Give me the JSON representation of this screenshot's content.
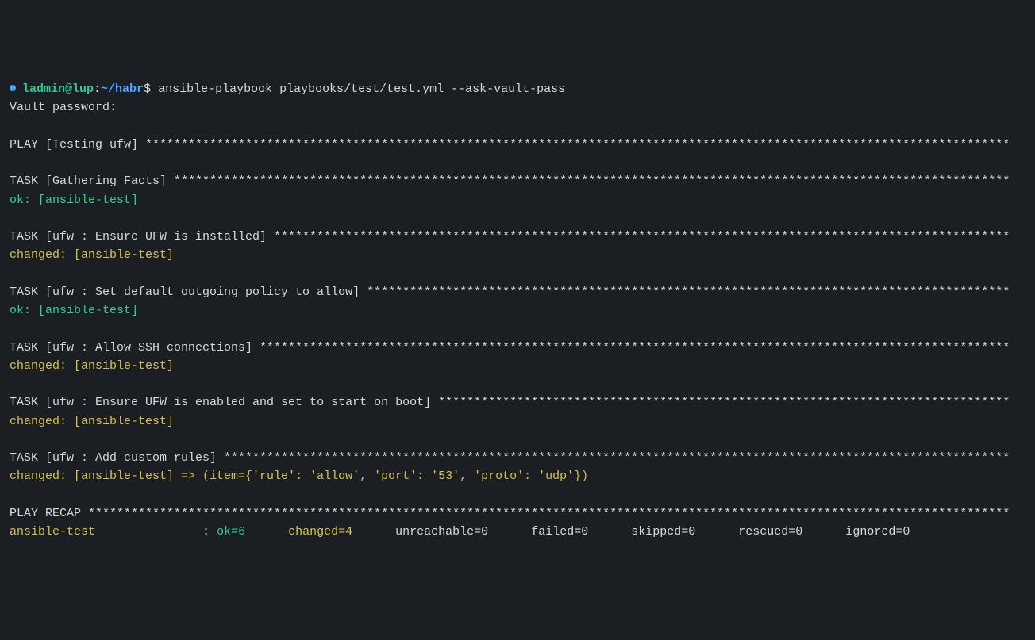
{
  "prompt": {
    "user_host": "ladmin@lup",
    "colon": ":",
    "path": "~/habr",
    "dollar": "$"
  },
  "command": "ansible-playbook playbooks/test/test.yml --ask-vault-pass",
  "vault_prompt": "Vault password:",
  "play_header": "PLAY [Testing ufw]",
  "tasks": [
    {
      "header": "TASK [Gathering Facts]",
      "result_prefix": "ok:",
      "result_body": " [ansible-test]",
      "result_class": "ok"
    },
    {
      "header": "TASK [ufw : Ensure UFW is installed]",
      "result_prefix": "changed:",
      "result_body": " [ansible-test]",
      "result_class": "changed"
    },
    {
      "header": "TASK [ufw : Set default outgoing policy to allow]",
      "result_prefix": "ok:",
      "result_body": " [ansible-test]",
      "result_class": "ok"
    },
    {
      "header": "TASK [ufw : Allow SSH connections]",
      "result_prefix": "changed:",
      "result_body": " [ansible-test]",
      "result_class": "changed"
    },
    {
      "header": "TASK [ufw : Ensure UFW is enabled and set to start on boot]",
      "result_prefix": "changed:",
      "result_body": " [ansible-test]",
      "result_class": "changed"
    },
    {
      "header": "TASK [ufw : Add custom rules]",
      "result_prefix": "changed:",
      "result_body": " [ansible-test] => (item={'rule': 'allow', 'port': '53', 'proto': 'udp'})",
      "result_class": "changed"
    }
  ],
  "recap_header": "PLAY RECAP",
  "recap": {
    "host": "ansible-test",
    "ok": "ok=6",
    "changed": "changed=4",
    "unreachable": "unreachable=0",
    "failed": "failed=0",
    "skipped": "skipped=0",
    "rescued": "rescued=0",
    "ignored": "ignored=0"
  },
  "colors": {
    "ok": "#2fcf8e",
    "changed": "#d6c24a",
    "bg": "#1b1f24"
  }
}
